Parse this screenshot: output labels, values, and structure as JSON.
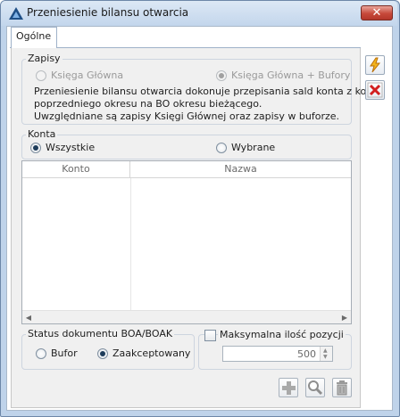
{
  "window": {
    "title": "Przeniesienie bilansu otwarcia",
    "close_label": "✕"
  },
  "tabs": [
    {
      "label": "Ogólne"
    }
  ],
  "zapisy": {
    "title": "Zapisy",
    "options": [
      {
        "label": "Księga Główna",
        "selected": false,
        "enabled": false
      },
      {
        "label": "Księga Główna + Bufory",
        "selected": true,
        "enabled": false
      }
    ],
    "description": [
      "Przeniesienie bilansu otwarcia dokonuje przepisania sald konta z końca",
      "poprzedniego okresu na BO okresu bieżącego.",
      "Uwzględniane są zapisy Księgi Głównej oraz zapisy w buforze."
    ]
  },
  "konta": {
    "title": "Konta",
    "options": [
      {
        "label": "Wszystkie",
        "selected": true
      },
      {
        "label": "Wybrane",
        "selected": false
      }
    ]
  },
  "grid": {
    "columns": [
      "Konto",
      "Nazwa"
    ],
    "rows": []
  },
  "status": {
    "title": "Status dokumentu BOA/BOAK",
    "options": [
      {
        "label": "Bufor",
        "selected": false
      },
      {
        "label": "Zaakceptowany",
        "selected": true
      }
    ]
  },
  "max_items": {
    "label": "Maksymalna ilość pozycji",
    "checked": false,
    "value": "500"
  },
  "colors": {
    "close_button": "#c7493a",
    "title_bar": "#c3d6ec",
    "panel": "#f0f0f0"
  }
}
